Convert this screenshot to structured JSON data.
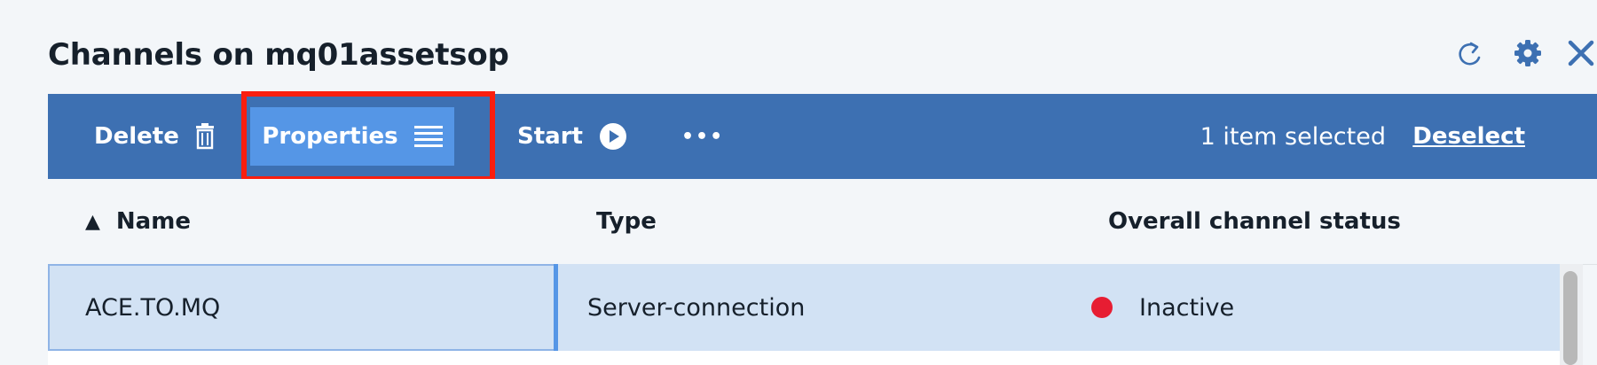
{
  "header": {
    "title": "Channels on mq01assetsop",
    "icons": [
      "refresh-icon",
      "settings-gear-icon",
      "close-icon"
    ]
  },
  "toolbar": {
    "delete_label": "Delete",
    "properties_label": "Properties",
    "start_label": "Start",
    "overflow_label": "•••",
    "selection_text": "1 item selected",
    "deselect_label": "Deselect"
  },
  "table": {
    "sort_indicator": "▲",
    "columns": [
      "Name",
      "Type",
      "Overall channel status"
    ],
    "rows": [
      {
        "name": "ACE.TO.MQ",
        "type": "Server-connection",
        "status": "Inactive",
        "status_color": "#e71d32"
      }
    ]
  },
  "colors": {
    "toolbar_bg": "#3d70b2",
    "active_button_bg": "#5596e6",
    "highlight_border": "#fa1e0e",
    "selected_row_bg": "#d2e2f4",
    "icon_blue": "#3d70b2"
  }
}
